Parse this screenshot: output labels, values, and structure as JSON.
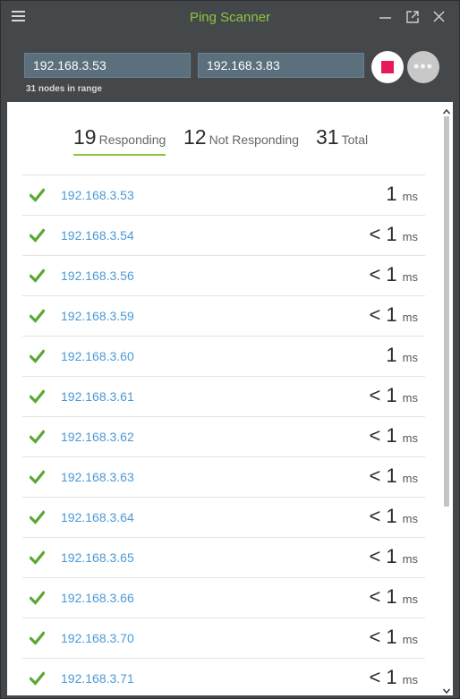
{
  "window": {
    "title": "Ping Scanner",
    "accent_color": "#8cc63f",
    "icons": [
      "menu-icon",
      "minimize-icon",
      "popout-icon",
      "close-icon"
    ]
  },
  "range": {
    "start_ip": "192.168.3.53",
    "end_ip": "192.168.3.83",
    "hint": "31 nodes in range"
  },
  "controls": {
    "stop_icon": "stop-icon",
    "stop_color": "#e8195a",
    "more_icon": "more-icon"
  },
  "summary": {
    "responding_count": "19",
    "responding_label": "Responding",
    "not_responding_count": "12",
    "not_responding_label": "Not Responding",
    "total_count": "31",
    "total_label": "Total"
  },
  "results": [
    {
      "ip": "192.168.3.53",
      "latency": "1",
      "unit": "ms",
      "status": "check-icon"
    },
    {
      "ip": "192.168.3.54",
      "latency": "< 1",
      "unit": "ms",
      "status": "check-icon"
    },
    {
      "ip": "192.168.3.56",
      "latency": "< 1",
      "unit": "ms",
      "status": "check-icon"
    },
    {
      "ip": "192.168.3.59",
      "latency": "< 1",
      "unit": "ms",
      "status": "check-icon"
    },
    {
      "ip": "192.168.3.60",
      "latency": "1",
      "unit": "ms",
      "status": "check-icon"
    },
    {
      "ip": "192.168.3.61",
      "latency": "< 1",
      "unit": "ms",
      "status": "check-icon"
    },
    {
      "ip": "192.168.3.62",
      "latency": "< 1",
      "unit": "ms",
      "status": "check-icon"
    },
    {
      "ip": "192.168.3.63",
      "latency": "< 1",
      "unit": "ms",
      "status": "check-icon"
    },
    {
      "ip": "192.168.3.64",
      "latency": "< 1",
      "unit": "ms",
      "status": "check-icon"
    },
    {
      "ip": "192.168.3.65",
      "latency": "< 1",
      "unit": "ms",
      "status": "check-icon"
    },
    {
      "ip": "192.168.3.66",
      "latency": "< 1",
      "unit": "ms",
      "status": "check-icon"
    },
    {
      "ip": "192.168.3.70",
      "latency": "< 1",
      "unit": "ms",
      "status": "check-icon"
    },
    {
      "ip": "192.168.3.71",
      "latency": "< 1",
      "unit": "ms",
      "status": "check-icon"
    }
  ],
  "colors": {
    "check": "#5aa832",
    "link": "#4a9ad6"
  }
}
